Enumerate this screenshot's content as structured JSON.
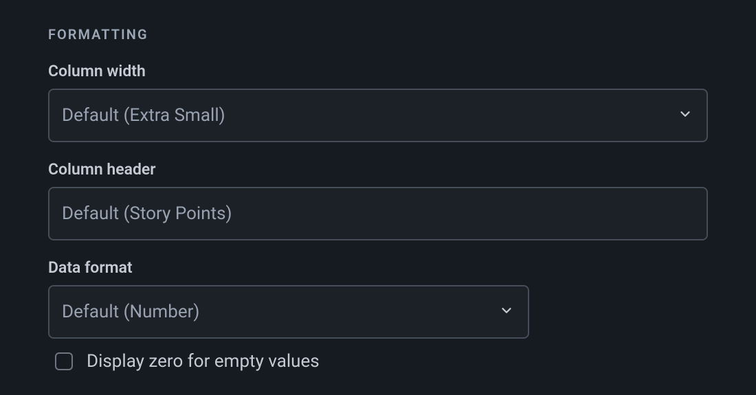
{
  "section_title": "FORMATTING",
  "column_width": {
    "label": "Column width",
    "value": "Default (Extra Small)"
  },
  "column_header": {
    "label": "Column header",
    "placeholder": "Default (Story Points)",
    "value": ""
  },
  "data_format": {
    "label": "Data format",
    "value": "Default (Number)"
  },
  "display_zero": {
    "label": "Display zero for empty values",
    "checked": false
  }
}
